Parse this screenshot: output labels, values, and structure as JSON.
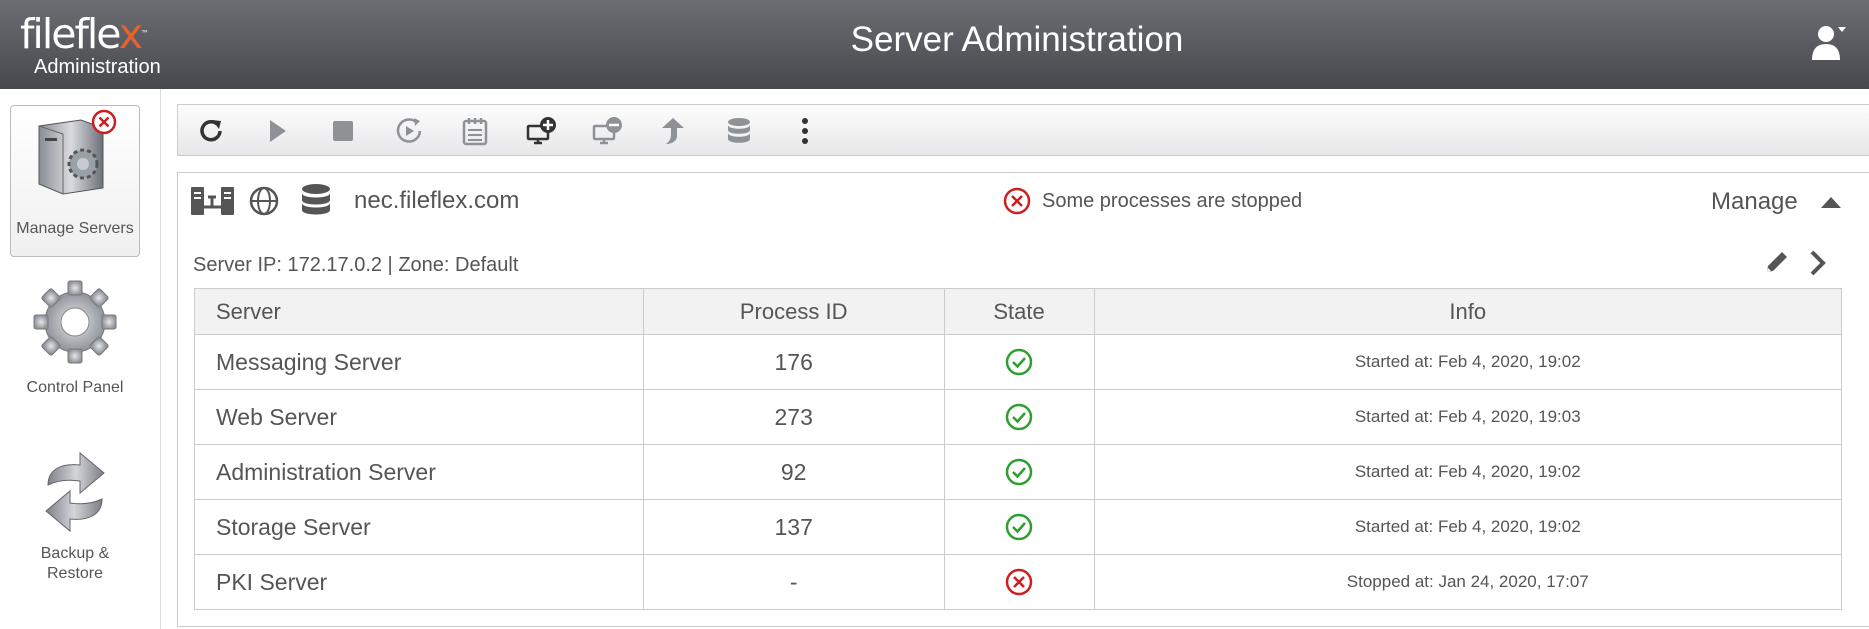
{
  "header": {
    "logo": {
      "word_main": "fileflex",
      "word_dot": "x",
      "tm": "™",
      "sub": "Administration"
    },
    "title": "Server Administration"
  },
  "sidebar": {
    "items": [
      {
        "label": "Manage Servers"
      },
      {
        "label": "Control Panel"
      },
      {
        "label": "Backup &",
        "label2": "Restore"
      }
    ]
  },
  "toolbar": {
    "buttons": [
      "refresh-icon",
      "play-icon",
      "stop-icon",
      "restart-icon",
      "schedule-icon",
      "add-server-icon",
      "remove-server-icon",
      "upgrade-icon",
      "database-icon",
      "more-icon"
    ]
  },
  "server": {
    "host": "nec.fileflex.com",
    "status_text": "Some processes are stopped",
    "manage_label": "Manage",
    "ip_line": "Server IP: 172.17.0.2 | Zone: Default",
    "columns": [
      "Server",
      "Process ID",
      "State",
      "Info"
    ],
    "rows": [
      {
        "name": "Messaging Server",
        "pid": "176",
        "state": "running",
        "info": "Started at: Feb 4, 2020, 19:02"
      },
      {
        "name": "Web Server",
        "pid": "273",
        "state": "running",
        "info": "Started at: Feb 4, 2020, 19:03"
      },
      {
        "name": "Administration Server",
        "pid": "92",
        "state": "running",
        "info": "Started at: Feb 4, 2020, 19:02"
      },
      {
        "name": "Storage Server",
        "pid": "137",
        "state": "running",
        "info": "Started at: Feb 4, 2020, 19:02"
      },
      {
        "name": "PKI Server",
        "pid": "-",
        "state": "stopped",
        "info": "Stopped at: Jan 24, 2020, 17:07"
      }
    ]
  },
  "colors": {
    "header_top": "#6c6e74",
    "header_bottom": "#46484e",
    "ok": "#2e9e2e",
    "error": "#cc1f1f",
    "logo_accent": "#e8612c"
  }
}
